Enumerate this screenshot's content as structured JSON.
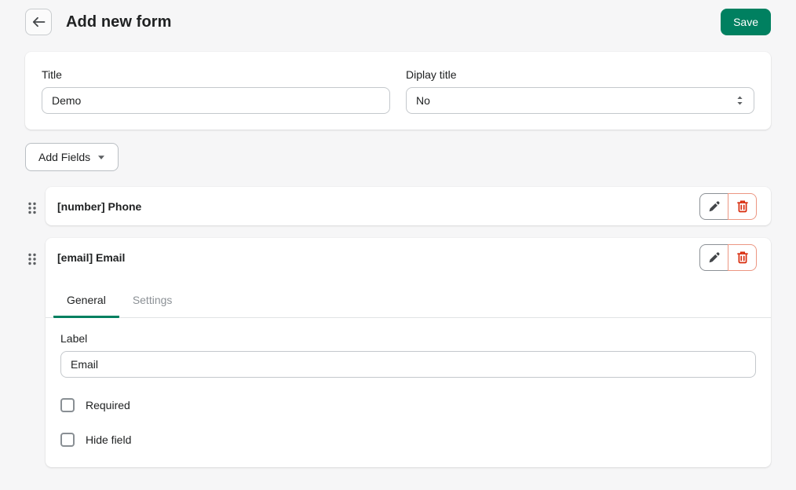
{
  "header": {
    "title": "Add new form",
    "save_label": "Save"
  },
  "form_card": {
    "title_label": "Title",
    "title_value": "Demo",
    "display_title_label": "Diplay title",
    "display_title_value": "No"
  },
  "add_fields": {
    "label": "Add Fields"
  },
  "fields": [
    {
      "title": "[number] Phone"
    },
    {
      "title": "[email] Email",
      "tabs": [
        {
          "label": "General"
        },
        {
          "label": "Settings"
        }
      ],
      "general": {
        "label_label": "Label",
        "label_value": "Email",
        "checkboxes": [
          {
            "label": "Required",
            "checked": false
          },
          {
            "label": "Hide field",
            "checked": false
          }
        ]
      }
    }
  ],
  "colors": {
    "primary_green": "#008060",
    "critical_red": "#d82c0d",
    "page_bg": "#f6f6f7"
  }
}
